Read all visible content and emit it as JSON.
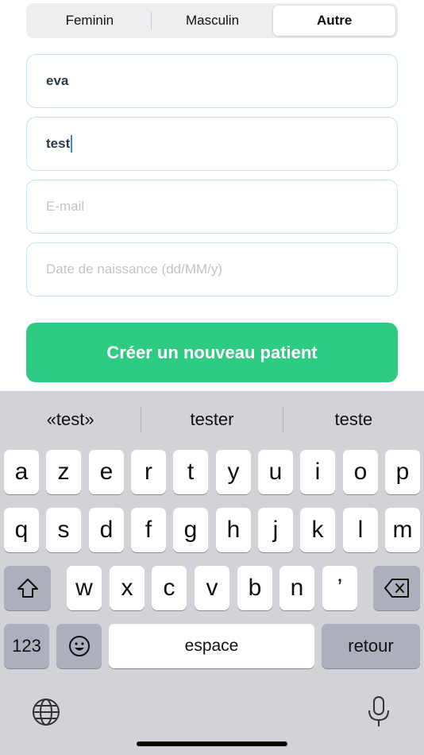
{
  "gender_selector": {
    "options": [
      "Feminin",
      "Masculin",
      "Autre"
    ],
    "selected": "Autre"
  },
  "form": {
    "first_name": {
      "value": "eva",
      "placeholder": ""
    },
    "last_name": {
      "value": "test",
      "placeholder": ""
    },
    "email": {
      "value": "",
      "placeholder": "E-mail"
    },
    "birthdate": {
      "value": "",
      "placeholder": "Date de naissance (dd/MM/y)"
    },
    "submit_label": "Créer un nouveau patient"
  },
  "keyboard": {
    "suggestions": [
      "«test»",
      "tester",
      "teste"
    ],
    "row1": [
      "a",
      "z",
      "e",
      "r",
      "t",
      "y",
      "u",
      "i",
      "o",
      "p"
    ],
    "row2": [
      "q",
      "s",
      "d",
      "f",
      "g",
      "h",
      "j",
      "k",
      "l",
      "m"
    ],
    "row3": [
      "w",
      "x",
      "c",
      "v",
      "b",
      "n",
      "’"
    ],
    "numbers_label": "123",
    "space_label": "espace",
    "return_label": "retour",
    "icons": [
      "shift-icon",
      "backspace-icon",
      "emoji-icon",
      "globe-icon",
      "microphone-icon"
    ]
  },
  "colors": {
    "accent_green": "#2ecc83",
    "field_border": "#bfe3f2",
    "caret": "#3b82f6",
    "keyboard_bg": "#d1d3d9"
  }
}
